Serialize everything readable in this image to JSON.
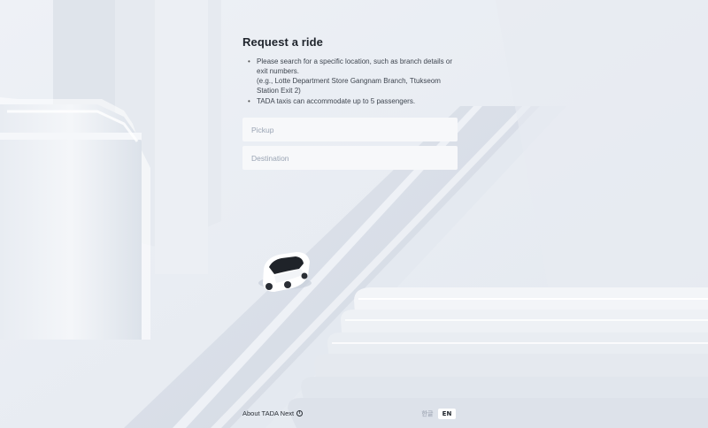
{
  "ride": {
    "title": "Request a ride",
    "bullets": {
      "b1_line1": "Please search for a specific location, such as branch details or exit numbers.",
      "b1_line2": "(e.g., Lotte Department Store Gangnam Branch, Ttukseom Station Exit 2)",
      "b2": "TADA taxis can accommodate up to 5 passengers."
    },
    "pickup": {
      "placeholder": "Pickup",
      "value": ""
    },
    "destination": {
      "placeholder": "Destination",
      "value": ""
    }
  },
  "footer": {
    "about_label": "About TADA Next",
    "info_icon": "info-icon",
    "info_glyph": "i"
  },
  "language": {
    "options": [
      "한글",
      "EN"
    ],
    "ko_label": "한글",
    "en_label": "EN",
    "selected": "EN"
  },
  "colors": {
    "background": "#e9edf3",
    "field_bg": "#f7f8fa",
    "placeholder": "#9aa4b4",
    "title": "#1e232b"
  }
}
